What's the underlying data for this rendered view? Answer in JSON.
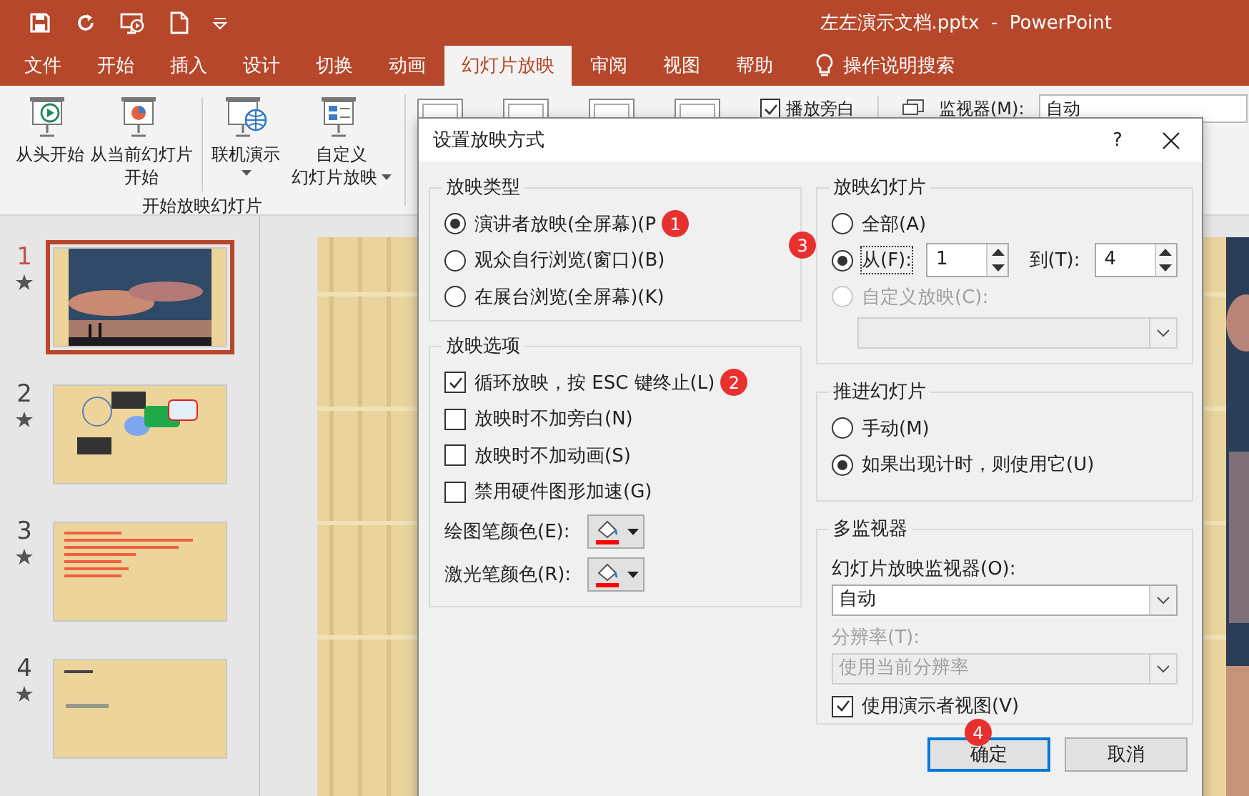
{
  "title": "左左演示文档.pptx  -  PowerPoint",
  "tabs": [
    {
      "label": "文件",
      "selected": false
    },
    {
      "label": "开始",
      "selected": false
    },
    {
      "label": "插入",
      "selected": false
    },
    {
      "label": "设计",
      "selected": false
    },
    {
      "label": "切换",
      "selected": false
    },
    {
      "label": "动画",
      "selected": false
    },
    {
      "label": "幻灯片放映",
      "selected": true
    },
    {
      "label": "审阅",
      "selected": false
    },
    {
      "label": "视图",
      "selected": false
    },
    {
      "label": "帮助",
      "selected": false
    }
  ],
  "search": {
    "label": "操作说明搜索"
  },
  "ribbon": {
    "buttons": [
      {
        "lines": [
          "从头开始"
        ],
        "dropdown": false
      },
      {
        "lines": [
          "从当前幻灯片",
          "开始"
        ],
        "dropdown": false
      },
      {
        "lines": [
          "联机演示"
        ],
        "dropdown": true
      },
      {
        "lines": [
          "自定义",
          "幻灯片放映"
        ],
        "dropdown": true
      }
    ],
    "group_label": "开始放映幻灯片",
    "narration": {
      "label": "播放旁白",
      "checked": true
    },
    "monitor": {
      "label": "监视器(M):",
      "value": "自动"
    }
  },
  "slides": [
    {
      "number": "1",
      "selected": true
    },
    {
      "number": "2",
      "selected": false
    },
    {
      "number": "3",
      "selected": false
    },
    {
      "number": "4",
      "selected": false
    }
  ],
  "dialog": {
    "title": "设置放映方式",
    "help": "?",
    "show_type": {
      "title": "放映类型",
      "options": [
        {
          "label": "演讲者放映(全屏幕)(P",
          "selected": true,
          "badge": "1"
        },
        {
          "label": "观众自行浏览(窗口)(B)",
          "selected": false
        },
        {
          "label": "在展台浏览(全屏幕)(K)",
          "selected": false
        }
      ]
    },
    "show_options": {
      "title": "放映选项",
      "options": [
        {
          "label": "循环放映，按 ESC 键终止(L)",
          "checked": true,
          "badge": "2"
        },
        {
          "label": "放映时不加旁白(N)",
          "checked": false
        },
        {
          "label": "放映时不加动画(S)",
          "checked": false
        },
        {
          "label": "禁用硬件图形加速(G)",
          "checked": false
        }
      ],
      "colors": [
        {
          "label": "绘图笔颜色(E):",
          "color": "#ff0000"
        },
        {
          "label": "激光笔颜色(R):",
          "color": "#ff0000"
        }
      ]
    },
    "slide_range": {
      "title": "放映幻灯片",
      "badge": "3",
      "all": {
        "label": "全部(A)",
        "selected": false
      },
      "from": {
        "label": "从(F):",
        "selected": true,
        "value": "1"
      },
      "to": {
        "label": "到(T):",
        "value": "4"
      },
      "custom": {
        "label": "自定义放映(C):",
        "selected": false,
        "disabled": true
      }
    },
    "advance": {
      "title": "推进幻灯片",
      "options": [
        {
          "label": "手动(M)",
          "selected": false
        },
        {
          "label": "如果出现计时，则使用它(U)",
          "selected": true
        }
      ]
    },
    "monitors": {
      "title": "多监视器",
      "monitor_label": "幻灯片放映监视器(O):",
      "monitor_value": "自动",
      "resolution_label": "分辨率(T):",
      "resolution_value": "使用当前分辨率",
      "resolution_disabled": true,
      "presenter_view": {
        "label": "使用演示者视图(V)",
        "checked": true
      }
    },
    "buttons": [
      {
        "label": "确定",
        "default": true,
        "badge": "4"
      },
      {
        "label": "取消",
        "default": false
      }
    ]
  }
}
